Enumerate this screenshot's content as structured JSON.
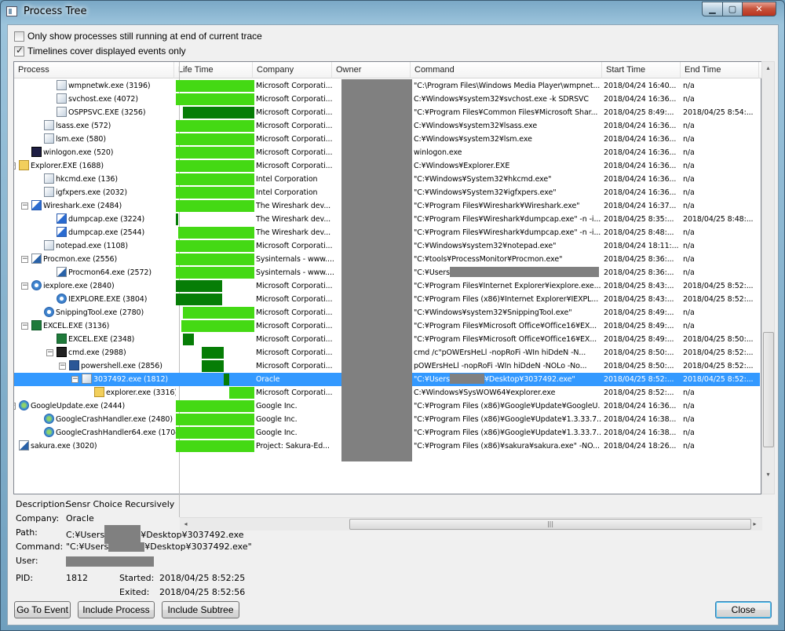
{
  "window": {
    "title": "Process Tree"
  },
  "options": {
    "only_running": "Only show processes still running at end of current trace",
    "timelines": "Timelines cover displayed events only"
  },
  "columns": [
    "Process",
    "Life Time",
    "Company",
    "Owner",
    "Command",
    "Start Time",
    "End Time"
  ],
  "rows": [
    {
      "level": 3,
      "icon": "window-icon",
      "name": "wmpnetwk.exe (3196)",
      "company": "Microsoft Corporati...",
      "command": "\"C:\\Program Files\\Windows Media Player\\wmpnet...",
      "start": "2018/04/24 16:40...",
      "end": "n/a",
      "bar": [
        0,
        100
      ],
      "dark": false
    },
    {
      "level": 3,
      "icon": "window-icon",
      "name": "svchost.exe (4072)",
      "company": "Microsoft Corporati...",
      "command": "C:¥Windows¥system32¥svchost.exe -k SDRSVC",
      "start": "2018/04/24 16:36...",
      "end": "n/a",
      "bar": [
        0,
        100
      ],
      "dark": false
    },
    {
      "level": 3,
      "icon": "window-icon",
      "name": "OSPPSVC.EXE (3256)",
      "company": "Microsoft Corporati...",
      "command": "\"C:¥Program Files¥Common Files¥Microsoft Shar...",
      "start": "2018/04/25 8:49:...",
      "end": "2018/04/25 8:54:...",
      "bar": [
        9,
        100
      ],
      "dark": true
    },
    {
      "level": 2,
      "icon": "window-icon",
      "name": "lsass.exe (572)",
      "company": "Microsoft Corporati...",
      "command": "C:¥Windows¥system32¥lsass.exe",
      "start": "2018/04/24 16:36...",
      "end": "n/a",
      "bar": [
        0,
        100
      ],
      "dark": false
    },
    {
      "level": 2,
      "icon": "window-icon",
      "name": "lsm.exe (580)",
      "company": "Microsoft Corporati...",
      "command": "C:¥Windows¥system32¥lsm.exe",
      "start": "2018/04/24 16:36...",
      "end": "n/a",
      "bar": [
        0,
        100
      ],
      "dark": false
    },
    {
      "level": 1,
      "icon": "winlogon-icon",
      "name": "winlogon.exe (520)",
      "company": "Microsoft Corporati...",
      "command": "winlogon.exe",
      "start": "2018/04/24 16:36...",
      "end": "n/a",
      "bar": [
        0,
        100
      ],
      "dark": false
    },
    {
      "level": 0,
      "icon": "folder-icon",
      "name": "Explorer.EXE (1688)",
      "company": "Microsoft Corporati...",
      "command": "C:¥Windows¥Explorer.EXE",
      "start": "2018/04/24 16:36...",
      "end": "n/a",
      "bar": [
        0,
        100
      ],
      "dark": false,
      "exp": true
    },
    {
      "level": 2,
      "icon": "window-icon",
      "name": "hkcmd.exe (136)",
      "company": "Intel Corporation",
      "command": "\"C:¥Windows¥System32¥hkcmd.exe\"",
      "start": "2018/04/24 16:36...",
      "end": "n/a",
      "bar": [
        0,
        100
      ],
      "dark": false
    },
    {
      "level": 2,
      "icon": "window-icon",
      "name": "igfxpers.exe (2032)",
      "company": "Intel Corporation",
      "command": "\"C:¥Windows¥System32¥igfxpers.exe\"",
      "start": "2018/04/24 16:36...",
      "end": "n/a",
      "bar": [
        0,
        100
      ],
      "dark": false
    },
    {
      "level": 1,
      "icon": "wireshark-icon",
      "name": "Wireshark.exe (2484)",
      "company": "The Wireshark dev...",
      "command": "\"C:¥Program Files¥Wireshark¥Wireshark.exe\"",
      "start": "2018/04/24 16:37...",
      "end": "n/a",
      "bar": [
        0,
        100
      ],
      "dark": false,
      "exp": true
    },
    {
      "level": 3,
      "icon": "wireshark-icon",
      "name": "dumpcap.exe (3224)",
      "company": "The Wireshark dev...",
      "command": "\"C:¥Program Files¥Wireshark¥dumpcap.exe\" -n -i...",
      "start": "2018/04/25 8:35:...",
      "end": "2018/04/25 8:48:...",
      "bar": [
        0,
        3
      ],
      "dark": true
    },
    {
      "level": 3,
      "icon": "wireshark-icon",
      "name": "dumpcap.exe (2544)",
      "company": "The Wireshark dev...",
      "command": "\"C:¥Program Files¥Wireshark¥dumpcap.exe\" -n -i...",
      "start": "2018/04/25 8:48:...",
      "end": "n/a",
      "bar": [
        3,
        100
      ],
      "dark": false
    },
    {
      "level": 2,
      "icon": "notepad-icon",
      "name": "notepad.exe (1108)",
      "company": "Microsoft Corporati...",
      "command": "\"C:¥Windows¥system32¥notepad.exe\"",
      "start": "2018/04/24 18:11:...",
      "end": "n/a",
      "bar": [
        0,
        100
      ],
      "dark": false
    },
    {
      "level": 1,
      "icon": "procmon-icon",
      "name": "Procmon.exe (2556)",
      "company": "Sysinternals - www....",
      "command": "\"C:¥tools¥ProcessMonitor¥Procmon.exe\"",
      "start": "2018/04/25 8:36:...",
      "end": "n/a",
      "bar": [
        0,
        100
      ],
      "dark": false,
      "exp": true
    },
    {
      "level": 3,
      "icon": "procmon-icon",
      "name": "Procmon64.exe (2572)",
      "company": "Sysinternals - www....",
      "command": "\"C:¥Users",
      "start": "2018/04/25 8:36:...",
      "end": "n/a",
      "bar": [
        0,
        100
      ],
      "dark": false,
      "redact_cmd": true
    },
    {
      "level": 1,
      "icon": "ie-icon",
      "name": "iexplore.exe (2840)",
      "company": "Microsoft Corporati...",
      "command": "\"C:¥Program Files¥Internet Explorer¥iexplore.exe...",
      "start": "2018/04/25 8:43:...",
      "end": "2018/04/25 8:52:...",
      "bar": [
        0,
        59
      ],
      "dark": true,
      "exp": true
    },
    {
      "level": 3,
      "icon": "ie-icon",
      "name": "IEXPLORE.EXE (3804)",
      "company": "Microsoft Corporati...",
      "command": "\"C:¥Program Files (x86)¥Internet Explorer¥IEXPL...",
      "start": "2018/04/25 8:43:...",
      "end": "2018/04/25 8:52:...",
      "bar": [
        0,
        59
      ],
      "dark": true
    },
    {
      "level": 2,
      "icon": "scissors-icon",
      "name": "SnippingTool.exe (2780)",
      "company": "Microsoft Corporati...",
      "command": "\"C:¥Windows¥system32¥SnippingTool.exe\"",
      "start": "2018/04/25 8:49:...",
      "end": "n/a",
      "bar": [
        9,
        100
      ],
      "dark": false
    },
    {
      "level": 1,
      "icon": "excel-icon",
      "name": "EXCEL.EXE (3136)",
      "company": "Microsoft Corporati...",
      "command": "\"C:¥Program Files¥Microsoft Office¥Office16¥EX...",
      "start": "2018/04/25 8:49:...",
      "end": "n/a",
      "bar": [
        7,
        100
      ],
      "dark": false,
      "exp": true
    },
    {
      "level": 3,
      "icon": "excel-icon",
      "name": "EXCEL.EXE (2348)",
      "company": "Microsoft Corporati...",
      "command": "\"C:¥Program Files¥Microsoft Office¥Office16¥EX...",
      "start": "2018/04/25 8:49:...",
      "end": "2018/04/25 8:50:...",
      "bar": [
        9,
        23
      ],
      "dark": true
    },
    {
      "level": 3,
      "icon": "cmd-icon",
      "name": "cmd.exe (2988)",
      "company": "Microsoft Corporati...",
      "command": "cmd  /c\"pOWErsHeLl -nopRoFi -WIn  hiDdeN -N...",
      "start": "2018/04/25 8:50:...",
      "end": "2018/04/25 8:52:...",
      "bar": [
        33,
        61
      ],
      "dark": true,
      "exp": true
    },
    {
      "level": 4,
      "icon": "powershell-icon",
      "name": "powershell.exe (2856)",
      "company": "Microsoft Corporati...",
      "command": "pOWErsHeLl -nopRoFi -WIn  hiDdeN -NOLo -No...",
      "start": "2018/04/25 8:50:...",
      "end": "2018/04/25 8:52:...",
      "bar": [
        33,
        61
      ],
      "dark": true,
      "exp": true
    },
    {
      "level": 5,
      "icon": "window-icon",
      "name": "3037492.exe (1812)",
      "company": "Oracle",
      "command": "\"C:¥Users",
      "cmd_tail": "¥Desktop¥3037492.exe\"",
      "start": "2018/04/25 8:52:...",
      "end": "2018/04/25 8:52:...",
      "bar": [
        61,
        68
      ],
      "dark": true,
      "sel": true,
      "exp": true,
      "redact_cmd": true
    },
    {
      "level": 6,
      "icon": "folder-icon",
      "name": "explorer.exe (3316)",
      "company": "Microsoft Corporati...",
      "command": "C:¥Windows¥SysWOW64¥explorer.exe",
      "start": "2018/04/25 8:52:...",
      "end": "n/a",
      "bar": [
        68,
        100
      ],
      "dark": false
    },
    {
      "level": 0,
      "icon": "google-update-icon",
      "name": "GoogleUpdate.exe (2444)",
      "company": "Google Inc.",
      "command": "\"C:¥Program Files (x86)¥Google¥Update¥GoogleU...",
      "start": "2018/04/24 16:36...",
      "end": "n/a",
      "bar": [
        0,
        100
      ],
      "dark": false,
      "exp": true
    },
    {
      "level": 2,
      "icon": "google-update-icon",
      "name": "GoogleCrashHandler.exe (2480)",
      "company": "Google Inc.",
      "command": "\"C:¥Program Files (x86)¥Google¥Update¥1.3.33.7...",
      "start": "2018/04/24 16:38...",
      "end": "n/a",
      "bar": [
        0,
        100
      ],
      "dark": false
    },
    {
      "level": 2,
      "icon": "google-update-icon",
      "name": "GoogleCrashHandler64.exe (1704)",
      "company": "Google Inc.",
      "command": "\"C:¥Program Files (x86)¥Google¥Update¥1.3.33.7...",
      "start": "2018/04/24 16:38...",
      "end": "n/a",
      "bar": [
        0,
        100
      ],
      "dark": false
    },
    {
      "level": 0,
      "icon": "sakura-icon",
      "name": "sakura.exe (3020)",
      "company": "Project: Sakura-Ed...",
      "command": "\"C:¥Program Files (x86)¥sakura¥sakura.exe\" -NO...",
      "start": "2018/04/24 18:26...",
      "end": "n/a",
      "bar": [
        0,
        100
      ],
      "dark": false
    }
  ],
  "details": {
    "description_label": "Description:",
    "description": "Sensr Choice Recursively",
    "company_label": "Company:",
    "company": "Oracle",
    "path_label": "Path:",
    "path_pre": "C:¥Users",
    "path_post": "¥Desktop¥3037492.exe",
    "command_label": "Command:",
    "command_pre": "\"C:¥Users",
    "command_post": "¥Desktop¥3037492.exe\"",
    "user_label": "User:",
    "pid_label": "PID:",
    "pid": "1812",
    "started_label": "Started:",
    "started": "2018/04/25 8:52:25",
    "exited_label": "Exited:",
    "exited": "2018/04/25 8:52:56"
  },
  "buttons": {
    "goto": "Go To Event",
    "include_process": "Include Process",
    "include_subtree": "Include Subtree",
    "close": "Close"
  },
  "scroll": {
    "grip": "|||"
  }
}
